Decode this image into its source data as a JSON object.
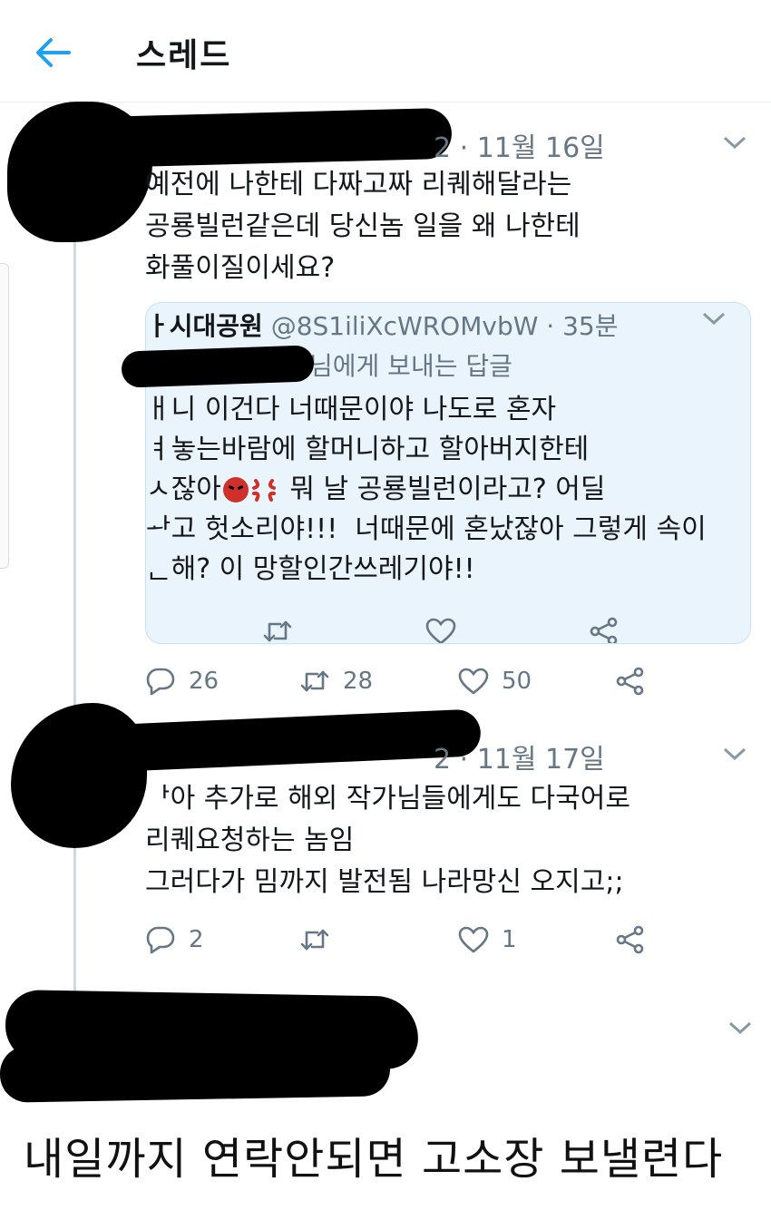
{
  "header": {
    "title": "스레드",
    "back_icon": "arrow-left-icon",
    "accent": "#1da1f2"
  },
  "tweets": [
    {
      "date": "2 · 11월 16일",
      "lines": [
        "예전에 나한테 다짜고짜 리퀘해달라는",
        "공룡빌런같은데 당신놈 일을 왜 나한테",
        "화풀이질이세요?"
      ],
      "quote": {
        "author_name": "ㅏ시대공원",
        "author_handle": "@8S1iliXcWROMvbW · 35분",
        "replying_to": "님에게 보내는 답글",
        "lines": [
          "ㅐ니 이건다 너때문이야 나도로 혼자",
          "ㅕ놓는바람에 할머니하고 할아버지한테"
        ],
        "line3_before_emoji": "ㅅ잖아",
        "line3_after_emoji": " 뭐 날 공룡빌런이라고? 어딜",
        "line4": "ᅪ고 헛소리야!!!  너때문에 혼났잖아 그렇게 속이",
        "line5": "ᆫ해? 이 망할인간쓰레기야!!",
        "emoji_icons": [
          "angry-face-icon",
          "anger-symbol-icon"
        ]
      },
      "counts": {
        "reply": "26",
        "retweet": "28",
        "like": "50"
      }
    },
    {
      "date": "2 · 11월 17일",
      "lines": [
        "ᅡ아 추가로 해외 작가님들에게도 다국어로",
        "리퀘요청하는 놈임",
        "그러다가 밈까지 발전됨 나라망신 오지고;;"
      ],
      "counts": {
        "reply": "2",
        "retweet": "",
        "like": "1"
      }
    }
  ],
  "caption": "내일까지 연락안되면 고소장 보낼련다",
  "colors": {
    "text": "#14171a",
    "meta": "#657786",
    "quote_bg": "#eaf4fd",
    "quote_border": "#c7e1f4",
    "thread_line": "#cfd9de"
  }
}
